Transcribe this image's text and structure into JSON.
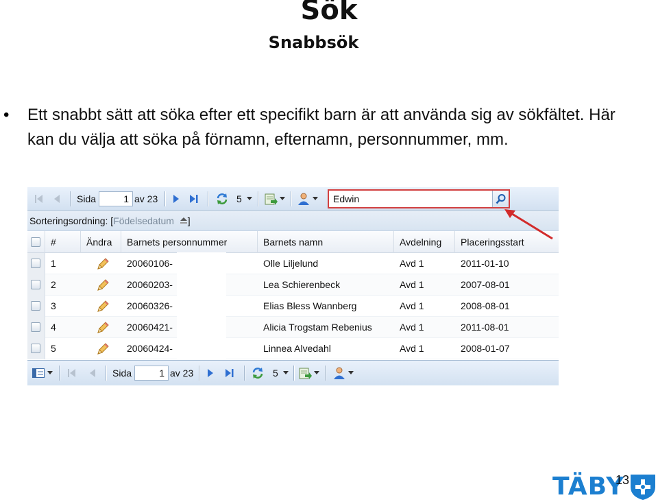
{
  "slide": {
    "title": "Sök",
    "subtitle": "Snabbsök",
    "bullet": "Ett snabbt sätt att söka efter ett specifikt barn är att använda sig av sökfältet. Här kan du välja att söka på förnamn, efternamn, personnummer, mm.",
    "page_number": "13",
    "logo_text": "TÄBY"
  },
  "toolbar": {
    "page_label": "Sida",
    "page_value": "1",
    "page_total": "av 23",
    "page_size": "5",
    "search_value": "Edwin"
  },
  "sort": {
    "label": "Sorteringsordning:",
    "field": "Födelsedatum"
  },
  "columns": [
    "#",
    "Ändra",
    "Barnets personnummer",
    "Barnets namn",
    "Avdelning",
    "Placeringsstart"
  ],
  "rows": [
    {
      "num": "1",
      "pnr": "20060106-",
      "name": "Olle Liljelund",
      "avd": "Avd 1",
      "start": "2011-01-10"
    },
    {
      "num": "2",
      "pnr": "20060203-",
      "name": "Lea Schierenbeck",
      "avd": "Avd 1",
      "start": "2007-08-01"
    },
    {
      "num": "3",
      "pnr": "20060326-",
      "name": "Elias Bless Wannberg",
      "avd": "Avd 1",
      "start": "2008-08-01"
    },
    {
      "num": "4",
      "pnr": "20060421-",
      "name": "Alicia Trogstam Rebenius",
      "avd": "Avd 1",
      "start": "2011-08-01"
    },
    {
      "num": "5",
      "pnr": "20060424-",
      "name": "Linnea Alvedahl",
      "avd": "Avd 1",
      "start": "2008-01-07"
    }
  ],
  "colors": {
    "highlight": "#d24040",
    "logo": "#1c7fd0",
    "toolbar_bg": "#d3e1f1",
    "nav_arrow": "#2f6fd1"
  },
  "icons": [
    "first-page-icon",
    "prev-page-icon",
    "next-page-icon",
    "last-page-icon",
    "refresh-icon",
    "export-icon",
    "user-filter-icon",
    "search-icon",
    "edit-pencil-icon",
    "column-menu-icon",
    "checkbox-icon"
  ]
}
